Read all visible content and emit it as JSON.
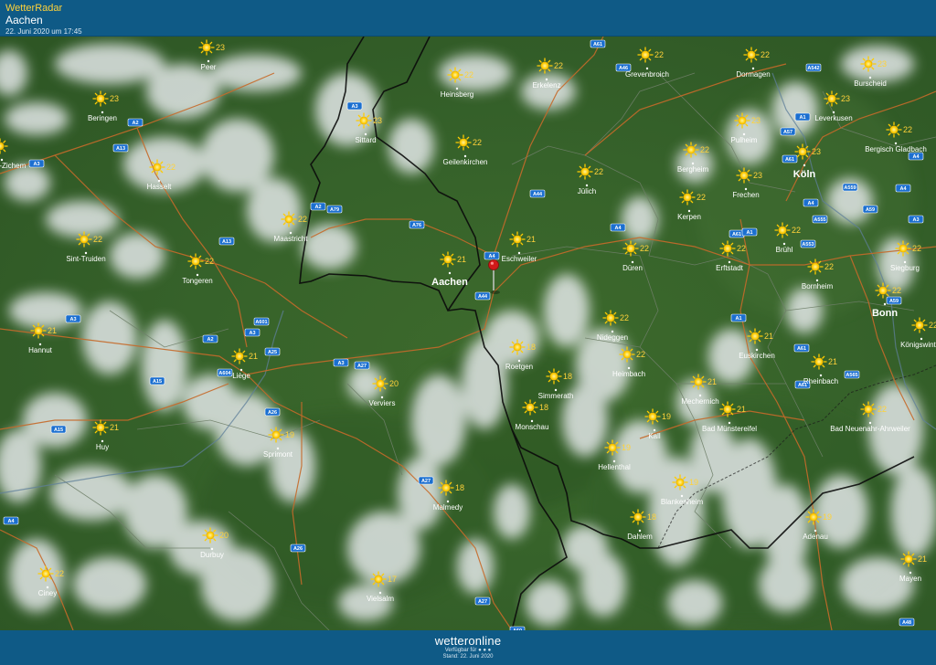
{
  "header": {
    "brand": "WetterRadar",
    "place": "Aachen",
    "timestamp": "22. Juni 2020 um 17:45"
  },
  "footer": {
    "logo": "wetteronline",
    "available": "Verfügbar für ● ● ●",
    "stand": "Stand: 22. Juni 2020"
  },
  "colors": {
    "header": "#0f5a86",
    "brand": "#ffd23a",
    "temp": "#ffd23a",
    "sun": "#ffcc00",
    "marker": "#d11a1a"
  },
  "icons": {
    "weather": "sun-icon",
    "pin": "location-pin-icon"
  },
  "cities": [
    {
      "name": "Peer",
      "temp": "23"
    },
    {
      "name": "Beringen",
      "temp": "23"
    },
    {
      "name": "heuvel-Zichem",
      "temp": ""
    },
    {
      "name": "Hasselt",
      "temp": "22"
    },
    {
      "name": "Sint-Truiden",
      "temp": "22"
    },
    {
      "name": "Tongeren",
      "temp": "22"
    },
    {
      "name": "Hannut",
      "temp": "21"
    },
    {
      "name": "Huy",
      "temp": "21"
    },
    {
      "name": "Liège",
      "temp": "21"
    },
    {
      "name": "Sprimont",
      "temp": "19"
    },
    {
      "name": "Durbuy",
      "temp": "20"
    },
    {
      "name": "Ciney",
      "temp": "22"
    },
    {
      "name": "Vielsalm",
      "temp": "17"
    },
    {
      "name": "Malmedy",
      "temp": "18"
    },
    {
      "name": "Verviers",
      "temp": "20"
    },
    {
      "name": "Maastricht",
      "temp": "22"
    },
    {
      "name": "Sittard",
      "temp": "23"
    },
    {
      "name": "Heinsberg",
      "temp": "22"
    },
    {
      "name": "Geilenkirchen",
      "temp": "22"
    },
    {
      "name": "Erkelenz",
      "temp": "22"
    },
    {
      "name": "Grevenbroich",
      "temp": "22"
    },
    {
      "name": "Dormagen",
      "temp": "22"
    },
    {
      "name": "Burscheid",
      "temp": "23"
    },
    {
      "name": "Leverkusen",
      "temp": "23"
    },
    {
      "name": "Pulheim",
      "temp": "23"
    },
    {
      "name": "Bergisch Gladbach",
      "temp": "22"
    },
    {
      "name": "Köln",
      "temp": "23"
    },
    {
      "name": "Frechen",
      "temp": "23"
    },
    {
      "name": "Bergheim",
      "temp": "22"
    },
    {
      "name": "Jülich",
      "temp": "22"
    },
    {
      "name": "Eschweiler",
      "temp": "21"
    },
    {
      "name": "Aachen",
      "temp": "21"
    },
    {
      "name": "Düren",
      "temp": "22"
    },
    {
      "name": "Kerpen",
      "temp": "22"
    },
    {
      "name": "Erftstadt",
      "temp": "22"
    },
    {
      "name": "Brühl",
      "temp": "22"
    },
    {
      "name": "Bornheim",
      "temp": "22"
    },
    {
      "name": "Siegburg",
      "temp": "22"
    },
    {
      "name": "Bonn",
      "temp": "22"
    },
    {
      "name": "Königswinter",
      "temp": "22"
    },
    {
      "name": "Euskirchen",
      "temp": "21"
    },
    {
      "name": "Rheinbach",
      "temp": "21"
    },
    {
      "name": "Bad Neuenahr-Ahrweiler",
      "temp": "22"
    },
    {
      "name": "Bad Münstereifel",
      "temp": "21"
    },
    {
      "name": "Mechernich",
      "temp": "21"
    },
    {
      "name": "Nideggen",
      "temp": "22"
    },
    {
      "name": "Heimbach",
      "temp": "22"
    },
    {
      "name": "Roetgen",
      "temp": "18"
    },
    {
      "name": "Simmerath",
      "temp": "18"
    },
    {
      "name": "Monschau",
      "temp": "18"
    },
    {
      "name": "Kall",
      "temp": "19"
    },
    {
      "name": "Hellenthal",
      "temp": "19"
    },
    {
      "name": "Blankenheim",
      "temp": "19"
    },
    {
      "name": "Dahlem",
      "temp": "18"
    },
    {
      "name": "Adenau",
      "temp": "19"
    },
    {
      "name": "Mayen",
      "temp": "21"
    }
  ],
  "roads": [
    "A61",
    "A46",
    "A542",
    "A1",
    "A57",
    "A3",
    "A61",
    "A4",
    "A4",
    "A559",
    "A59",
    "A44",
    "A4",
    "A4",
    "A61",
    "A1",
    "A553",
    "A555",
    "A565",
    "A3",
    "A59",
    "A2",
    "A13",
    "A3",
    "A2",
    "A79",
    "A76",
    "A4",
    "A44",
    "A13",
    "A3",
    "A601",
    "A2",
    "A3",
    "A25",
    "A604",
    "A27",
    "A3",
    "A15",
    "A15",
    "A26",
    "A27",
    "A26",
    "A4",
    "A27",
    "A61",
    "A1",
    "A48",
    "A60",
    "A61"
  ]
}
